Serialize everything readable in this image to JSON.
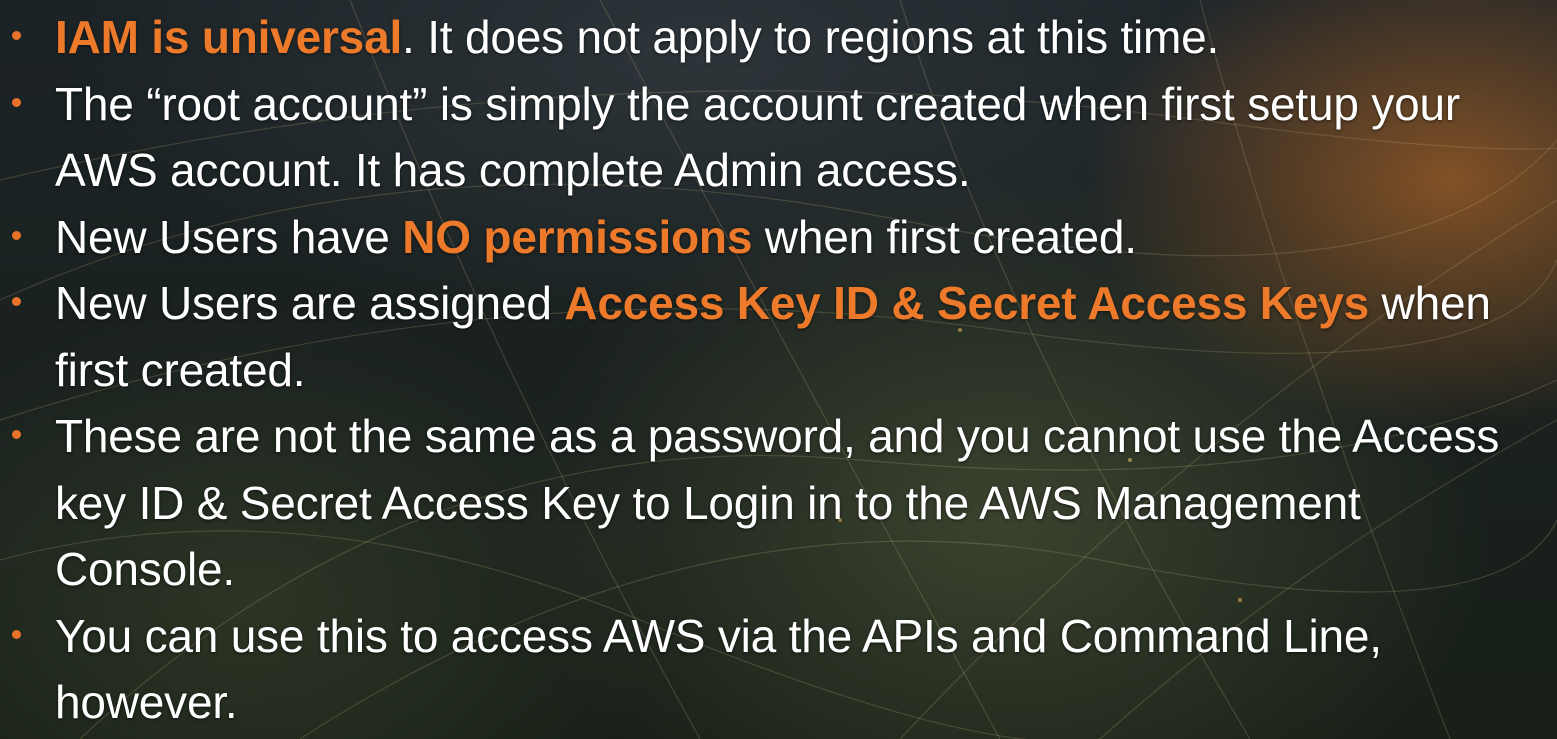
{
  "colors": {
    "highlight": "#ec7a2a",
    "bullet": "#e8722a",
    "text": "#ffffff"
  },
  "bullets": [
    {
      "highlight": "IAM is universal",
      "after": ". It does not apply to regions at this time."
    },
    {
      "text": "The “root account” is simply the account created when first setup your AWS account. It has complete Admin access."
    },
    {
      "before": "New Users have ",
      "highlight": "NO permissions",
      "after": " when first created."
    },
    {
      "before": "New Users are assigned ",
      "highlight": "Access Key ID & Secret Access Keys",
      "after": " when first created."
    },
    {
      "text": "These are not the same as a password, and you cannot use the Access key ID & Secret Access Key to Login in to the AWS Management Console."
    },
    {
      "text": "You can use this to access AWS via the APIs and Command Line, however."
    }
  ]
}
